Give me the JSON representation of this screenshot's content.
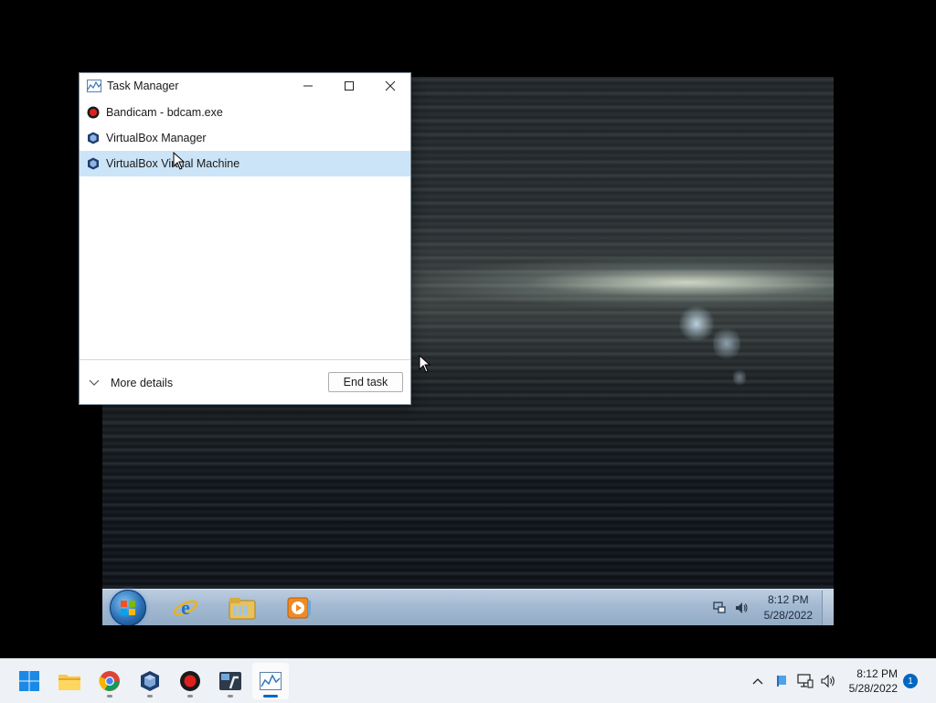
{
  "task_manager": {
    "title": "Task Manager",
    "processes": [
      {
        "name": "Bandicam - bdcam.exe",
        "icon": "bandicam-record-icon",
        "selected": false
      },
      {
        "name": "VirtualBox Manager",
        "icon": "virtualbox-icon",
        "selected": false
      },
      {
        "name": "VirtualBox Virtual Machine",
        "icon": "virtualbox-icon",
        "selected": true
      }
    ],
    "more_details_label": "More details",
    "end_task_label": "End task"
  },
  "vm": {
    "taskbar": {
      "apps": [
        "windows7-start-orb",
        "internet-explorer-icon",
        "windows-explorer-icon",
        "media-player-icon"
      ],
      "clock_time": "8:12 PM",
      "clock_date": "5/28/2022"
    }
  },
  "host_taskbar": {
    "apps": [
      "windows-start-icon",
      "file-explorer-icon",
      "chrome-icon",
      "virtualbox-icon",
      "bandicam-icon",
      "windows7-logo-app-icon",
      "task-manager-icon"
    ],
    "clock_time": "8:12 PM",
    "clock_date": "5/28/2022",
    "notification_count": "1"
  },
  "colors": {
    "selection": "#cce4f7",
    "accent": "#0067c0",
    "bandicam_red": "#e02020"
  }
}
